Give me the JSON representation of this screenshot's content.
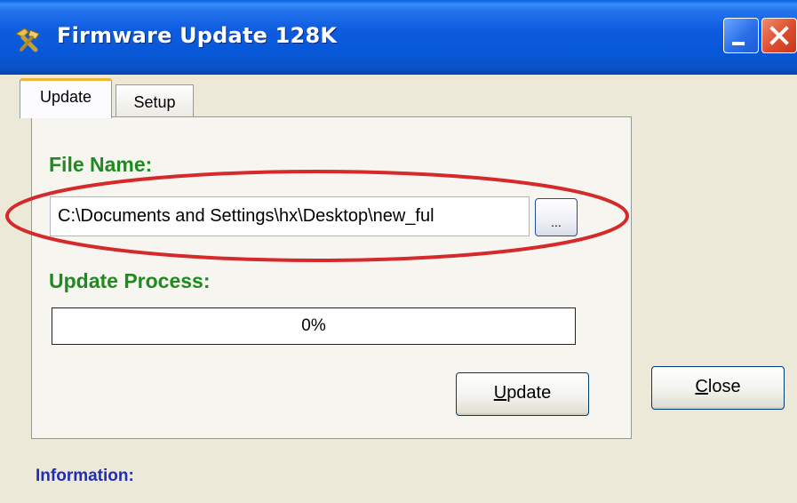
{
  "window": {
    "title": "Firmware Update 128K",
    "icon": "gear-tool-icon",
    "controls": [
      "minimize-icon",
      "close-icon"
    ]
  },
  "tabs": [
    {
      "label": "Update",
      "selected": true
    },
    {
      "label": "Setup",
      "selected": false
    }
  ],
  "update_panel": {
    "file_name_label": "File Name:",
    "file_path": "C:\\Documents and Settings\\hx\\Desktop\\new_ful",
    "browse_label": "...",
    "process_label": "Update Process:",
    "progress": {
      "value": 0,
      "text": "0%"
    },
    "update_button": {
      "mnemonic": "U",
      "rest": "pdate"
    }
  },
  "close_button": {
    "mnemonic": "C",
    "rest": "lose"
  },
  "information_label": "Information:",
  "colors": {
    "title_bar": "#0758d8",
    "section_label": "#1f8a1f",
    "info_label": "#1f2db8",
    "highlight": "#d42a2a",
    "tab_highlight": "#f3b538"
  }
}
